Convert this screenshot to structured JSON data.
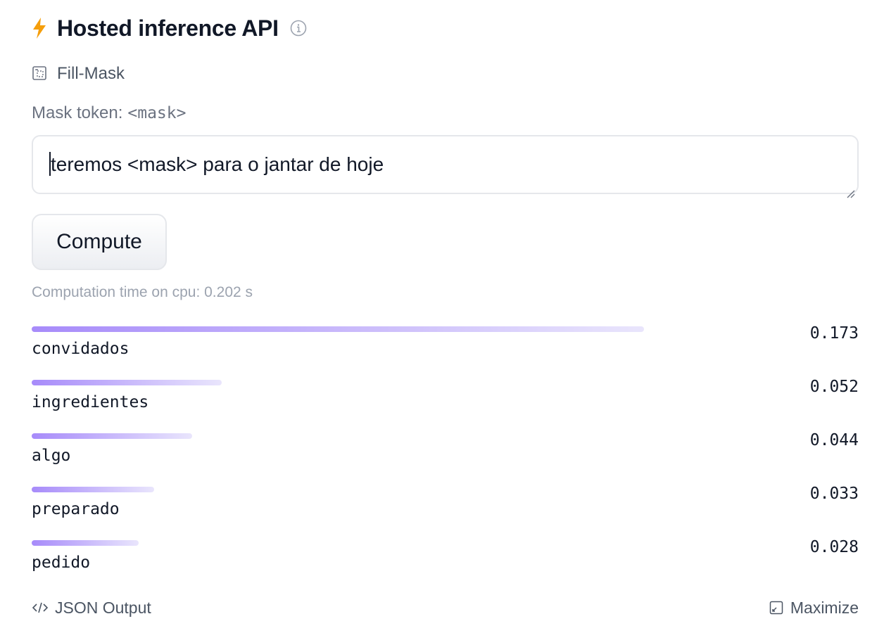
{
  "header": {
    "title": "Hosted inference API",
    "bolt_color": "#f59e0b",
    "icons": [
      "lightning-bolt-icon",
      "info-icon"
    ]
  },
  "task": {
    "label": "Fill-Mask",
    "icon": "fill-mask-icon"
  },
  "mask": {
    "label": "Mask token:",
    "token": "<mask>"
  },
  "input": {
    "value": "teremos <mask> para o jantar de hoje"
  },
  "compute": {
    "label": "Compute"
  },
  "status": {
    "computation_time": "Computation time on cpu: 0.202 s"
  },
  "results": [
    {
      "token": "convidados",
      "score_label": "0.173",
      "fraction": 0.74
    },
    {
      "token": "ingredientes",
      "score_label": "0.052",
      "fraction": 0.23
    },
    {
      "token": "algo",
      "score_label": "0.044",
      "fraction": 0.194
    },
    {
      "token": "preparado",
      "score_label": "0.033",
      "fraction": 0.148
    },
    {
      "token": "pedido",
      "score_label": "0.028",
      "fraction": 0.129
    }
  ],
  "colors": {
    "bar_start": "#a78bfa",
    "bar_end": "#e9e5fc"
  },
  "footer": {
    "json_output_label": "JSON Output",
    "maximize_label": "Maximize"
  }
}
